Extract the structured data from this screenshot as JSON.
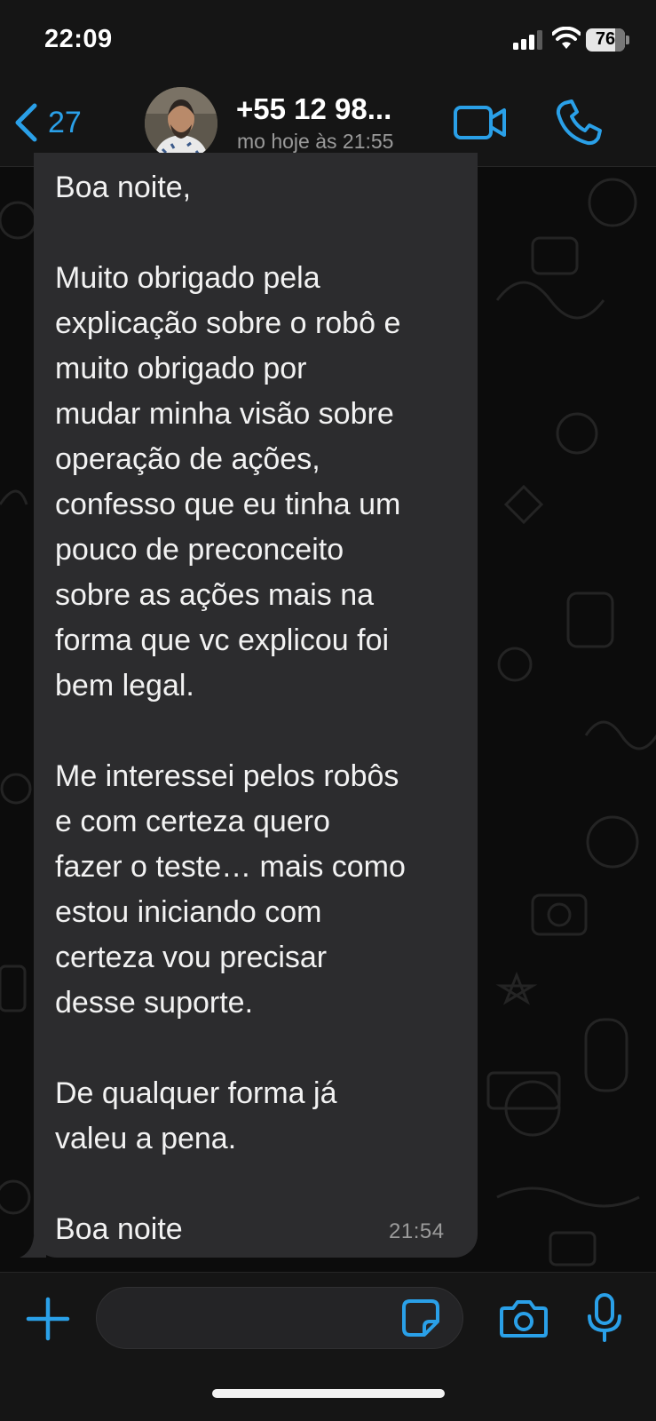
{
  "status_bar": {
    "time": "22:09",
    "battery_level": "76",
    "battery_fraction": 0.76,
    "icons": [
      "signal-icon",
      "wifi-icon",
      "battery-icon"
    ]
  },
  "header": {
    "back_count": "27",
    "contact_name": "+55 12 98...",
    "contact_status": "mo hoje às 21:55",
    "icons": [
      "chevron-left-icon",
      "video-camera-icon",
      "phone-icon"
    ]
  },
  "message": {
    "text": "Boa noite,\n\nMuito obrigado pela\nexplicação sobre o robô e\nmuito obrigado por\nmudar minha visão sobre\noperação de ações,\nconfesso que eu tinha um\npouco de preconceito\nsobre as ações mais na\nforma que vc explicou foi\nbem legal.\n\nMe interessei pelos robôs\ne com certeza quero\nfazer o teste… mais como\nestou iniciando com\ncerteza vou precisar\ndesse suporte.\n\nDe qualquer forma já\nvaleu a pena.\n\nBoa noite",
    "time": "21:54"
  },
  "input_bar": {
    "placeholder": "",
    "icons": [
      "plus-icon",
      "sticker-icon",
      "camera-icon",
      "microphone-icon"
    ]
  },
  "colors": {
    "accent": "#2aa0e8",
    "bubble": "#2c2c2e",
    "background": "#0b0b0b",
    "bar": "#151515"
  }
}
